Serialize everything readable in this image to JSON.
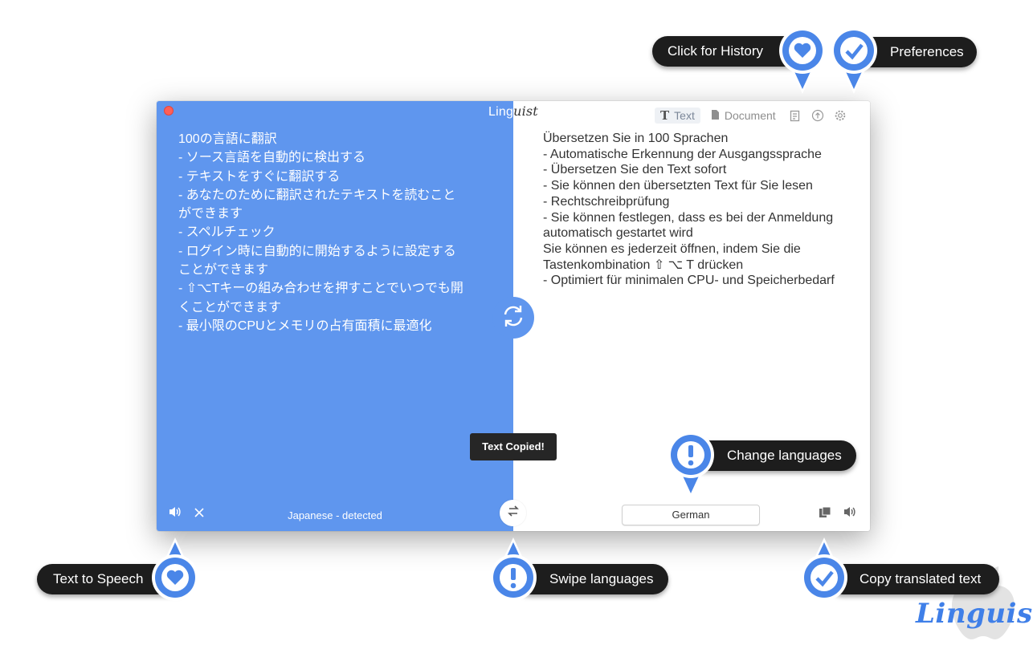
{
  "app": {
    "title_prefix": "Ling",
    "title_suffix": "uist"
  },
  "toolbar": {
    "tabs": [
      {
        "label": "Text",
        "icon": "text-icon",
        "active": true
      },
      {
        "label": "Document",
        "icon": "document-icon",
        "active": false
      }
    ],
    "history_icon": "history-icon",
    "upload_icon": "upload-icon",
    "settings_icon": "gear-icon"
  },
  "source": {
    "text": "100の言語に翻訳\n- ソース言語を自動的に検出する\n- テキストをすぐに翻訳する\n- あなたのために翻訳されたテキストを読むこと\nができます\n- スペルチェック\n- ログイン時に自動的に開始するように設定する\nことができます\n- ⇧⌥Tキーの組み合わせを押すことでいつでも開\nくことができます\n- 最小限のCPUとメモリの占有面積に最適化",
    "language": "Japanese - detected"
  },
  "target": {
    "text": "Übersetzen Sie in 100 Sprachen\n- Automatische Erkennung der Ausgangssprache\n- Übersetzen Sie den Text sofort\n- Sie können den übersetzten Text für Sie lesen\n- Rechtschreibprüfung\n- Sie können festlegen, dass es bei der Anmeldung\nautomatisch gestartet wird\nSie können es jederzeit öffnen, indem Sie die\nTastenkombination ⇧ ⌥ T drücken\n- Optimiert für minimalen CPU- und Speicherbedarf",
    "language": "German"
  },
  "toast": "Text Copied!",
  "callouts": {
    "history": "Click for History",
    "preferences": "Preferences",
    "change_languages": "Change languages",
    "text_to_speech": "Text to Speech",
    "swipe_languages": "Swipe languages",
    "copy_translated": "Copy translated text"
  },
  "brand": {
    "name": "Linguist",
    "overlay": "osx"
  },
  "colors": {
    "accent": "#5f96ee",
    "callout_bg": "#1d1d1d",
    "badge_fill": "#4a86e8"
  }
}
